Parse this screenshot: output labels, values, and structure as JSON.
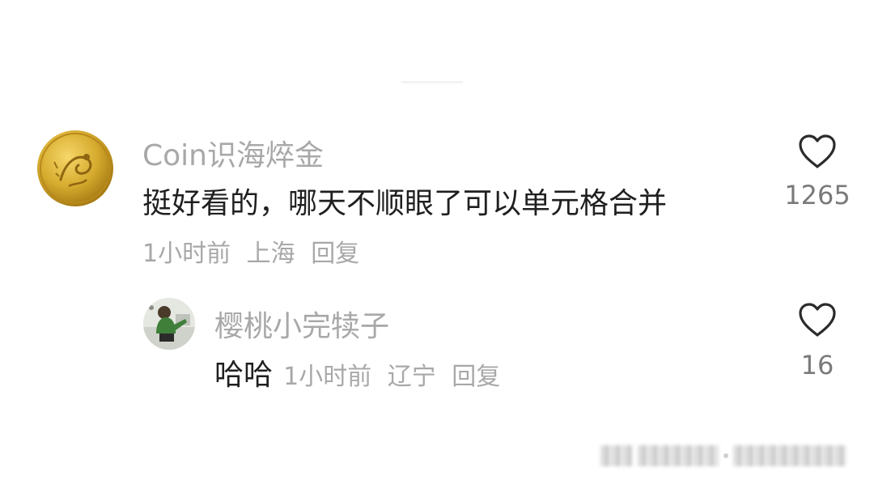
{
  "comments": [
    {
      "username": "Coin识海焠金",
      "text": "挺好看的，哪天不顺眼了可以单元格合并",
      "time": "1小时前",
      "location": "上海",
      "reply_label": "回复",
      "like_count": "1265",
      "avatar_icon": "gold-dragon-coin-avatar",
      "replies": [
        {
          "username": "樱桃小完犊子",
          "text": "哈哈",
          "time": "1小时前",
          "location": "辽宁",
          "reply_label": "回复",
          "like_count": "16",
          "avatar_icon": "cartoon-figure-avatar"
        }
      ]
    }
  ],
  "colors": {
    "username": "#a8a8a8",
    "content": "#1f1f1f",
    "meta": "#a8a8a8",
    "like_count": "#7a7a7a",
    "heart_stroke": "#2b2b2b",
    "coin_gold": "#d9b23a"
  },
  "watermark_icon": "blurred-watermark"
}
